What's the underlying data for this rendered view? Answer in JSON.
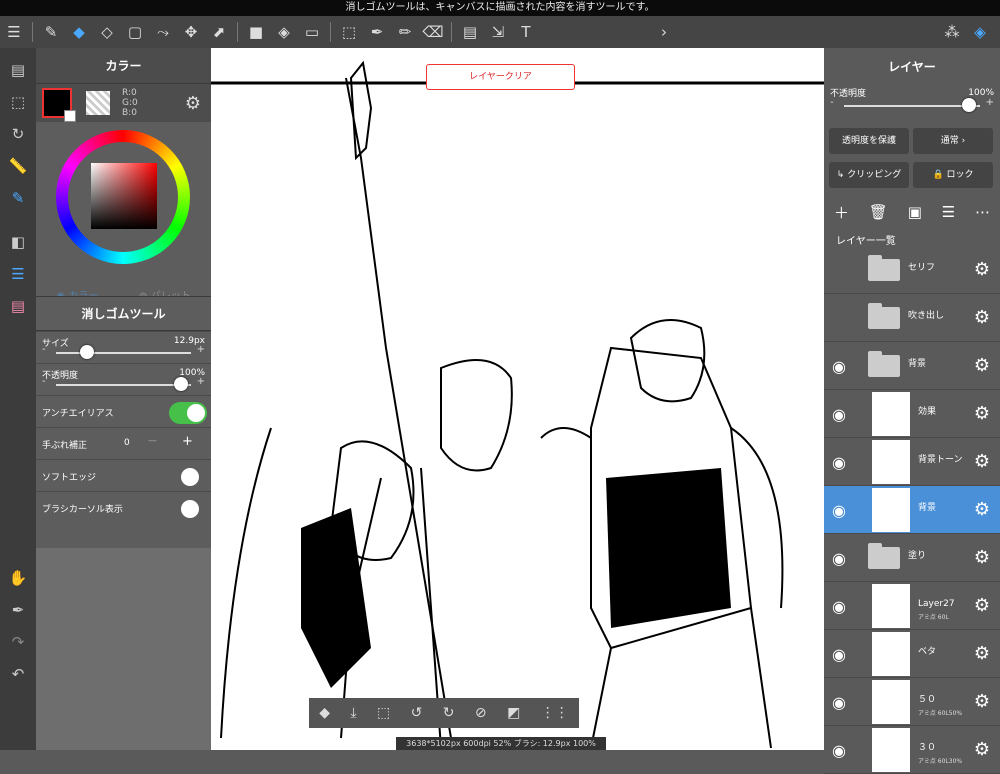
{
  "statusbar": {
    "message": "消しゴムツールは、キャンバスに描画された内容を消すツールです。"
  },
  "toolbar": {
    "icons": [
      "menu-icon",
      "brush-icon",
      "eraser-icon",
      "blur-eraser-icon",
      "rect-select-icon",
      "lasso-icon",
      "move-icon",
      "transform-icon",
      "fill-rect-icon",
      "bucket-icon",
      "gradient-icon",
      "select-pen-icon",
      "eyedropper-icon",
      "select-brush-icon",
      "select-eraser-icon",
      "select-layer-icon",
      "move-select-icon",
      "text-icon",
      "three-dots-icon",
      "layers-icon"
    ]
  },
  "color_panel": {
    "title": "カラー",
    "r": "R:0",
    "g": "G:0",
    "b": "B:0",
    "mode1": "カラー",
    "mode2": "パレット"
  },
  "tool_panel": {
    "title": "消しゴムツール",
    "size_label": "サイズ",
    "size_value": "12.9px",
    "opacity_label": "不透明度",
    "opacity_value": "100%",
    "antialias_label": "アンチエイリアス",
    "stabilizer_label": "手ぶれ補正",
    "stabilizer_value": "0",
    "softedge_label": "ソフトエッジ",
    "cursor_label": "ブラシカーソル表示",
    "minus": "-",
    "plus": "+",
    "stab_minus": "—"
  },
  "canvas": {
    "clear_button": "レイヤークリア",
    "info": "3638*5102px 600dpi 52% ブラシ: 12.9px 100%"
  },
  "layer_panel": {
    "title": "レイヤー",
    "opacity_label": "不透明度",
    "opacity_value": "100%",
    "protect_label": "透明度を保護",
    "blend_label": "通常",
    "clipping_label": "クリッピング",
    "lock_label": "ロック",
    "list_title": "レイヤー一覧",
    "layers": [
      {
        "name": "セリフ",
        "sub": "",
        "type": "folder",
        "visible": false,
        "selected": false
      },
      {
        "name": "吹き出し",
        "sub": "",
        "type": "folder",
        "visible": false,
        "selected": false
      },
      {
        "name": "背景",
        "sub": "",
        "type": "folder",
        "visible": true,
        "selected": false
      },
      {
        "name": "効果",
        "sub": "",
        "type": "layer",
        "visible": true,
        "selected": false
      },
      {
        "name": "背景トーン",
        "sub": "",
        "type": "layer",
        "visible": true,
        "selected": false
      },
      {
        "name": "背景",
        "sub": "",
        "type": "layer",
        "visible": true,
        "selected": true
      },
      {
        "name": "塗り",
        "sub": "",
        "type": "folder",
        "visible": true,
        "selected": false
      },
      {
        "name": "Layer27",
        "sub": "アミ点 60L",
        "type": "layer",
        "visible": true,
        "selected": false
      },
      {
        "name": "ベタ",
        "sub": "",
        "type": "layer",
        "visible": true,
        "selected": false
      },
      {
        "name": "５０",
        "sub": "アミ点 60L50%",
        "type": "layer",
        "visible": true,
        "selected": false
      },
      {
        "name": "３０",
        "sub": "アミ点 60L30%",
        "type": "layer",
        "visible": true,
        "selected": false
      }
    ]
  }
}
